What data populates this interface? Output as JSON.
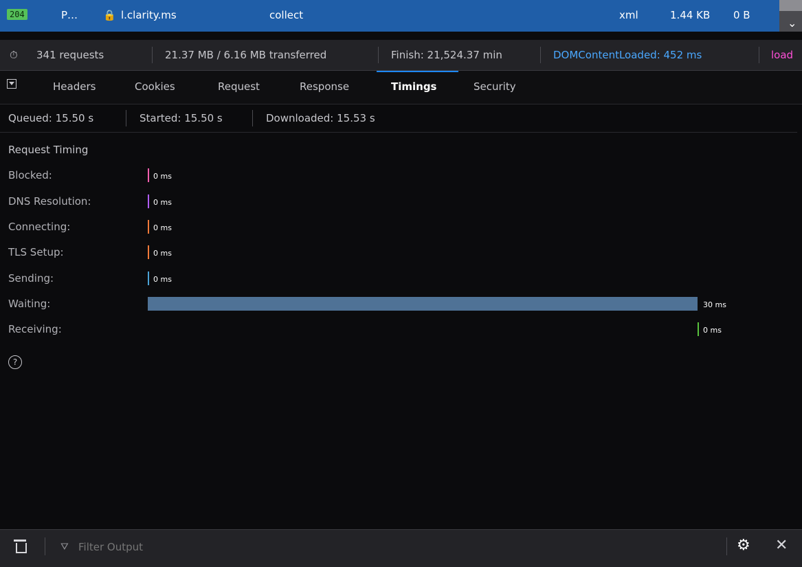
{
  "request": {
    "status": "204",
    "method": "P…",
    "domain": "l.clarity.ms",
    "file": "collect",
    "type": "xml",
    "transferred": "1.44 KB",
    "size": "0 B"
  },
  "summary": {
    "requests": "341 requests",
    "size": "21.37 MB / 6.16 MB transferred",
    "finish": "Finish: 21,524.37 min",
    "dom": "DOMContentLoaded: 452 ms",
    "load": "load"
  },
  "tabs": [
    "Headers",
    "Cookies",
    "Request",
    "Response",
    "Timings",
    "Security"
  ],
  "timing_summary": {
    "queued": "Queued: 15.50 s",
    "started": "Started: 15.50 s",
    "downloaded": "Downloaded: 15.53 s"
  },
  "request_timing": {
    "title": "Request Timing",
    "rows": [
      {
        "label": "Blocked:",
        "value": "0 ms",
        "color": "#ff5faf"
      },
      {
        "label": "DNS Resolution:",
        "value": "0 ms",
        "color": "#b15dff"
      },
      {
        "label": "Connecting:",
        "value": "0 ms",
        "color": "#f27a3a"
      },
      {
        "label": "TLS Setup:",
        "value": "0 ms",
        "color": "#f27a3a"
      },
      {
        "label": "Sending:",
        "value": "0 ms",
        "color": "#4ba3d6"
      },
      {
        "label": "Waiting:",
        "value": "30 ms",
        "color": "#4f7296"
      },
      {
        "label": "Receiving:",
        "value": "0 ms",
        "color": "#59c23d"
      }
    ]
  },
  "console": {
    "filter_placeholder": "Filter Output"
  },
  "colors": {
    "accent": "#1e88ff",
    "selected_row": "#1f5ea8",
    "status_ok": "#56c15a",
    "dom_content_loaded": "#4aa8ff",
    "load": "#ff4fd8"
  }
}
